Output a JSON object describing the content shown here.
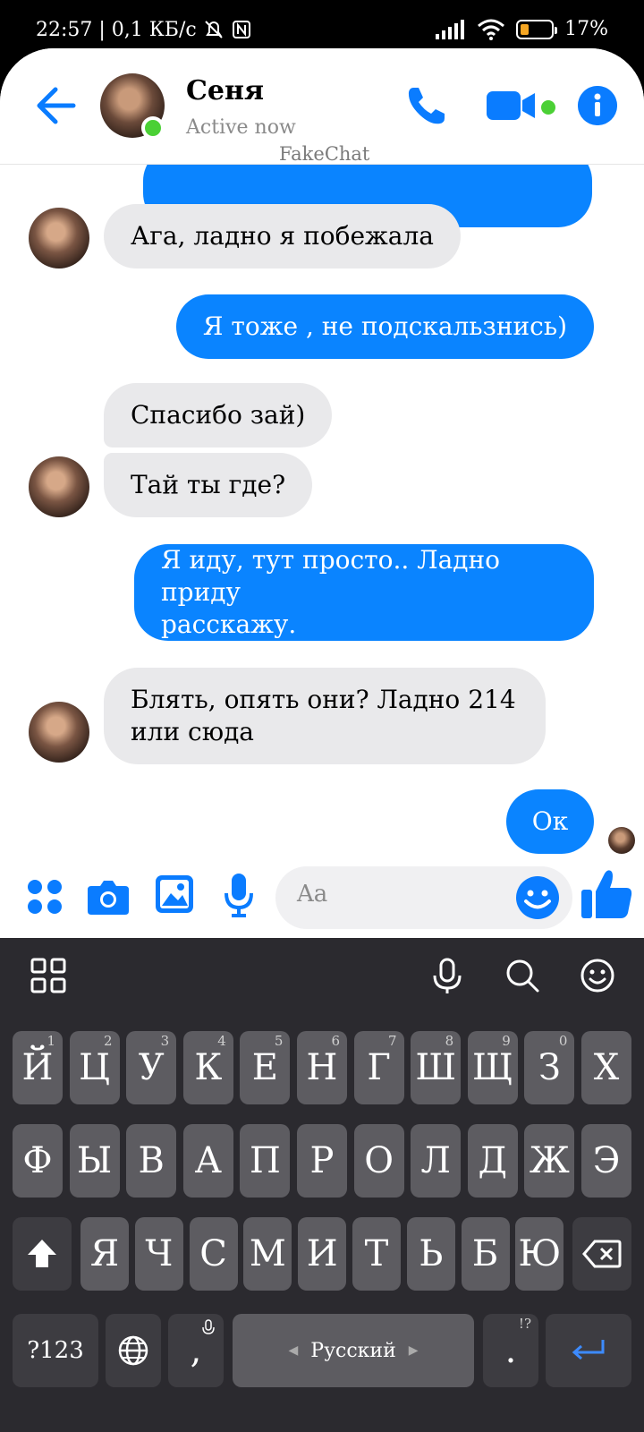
{
  "status_bar": {
    "time_and_speed": "22:57 | 0,1 КБ/с",
    "battery_percent": "17%",
    "battery_level": 0.17
  },
  "header": {
    "contact_name": "Сеня",
    "contact_status": "Active now",
    "watermark": "FakeChat"
  },
  "messages": [
    {
      "text": "Ага, ладно я побежала"
    },
    {
      "text": "Я тоже , не подскальзнись)"
    },
    {
      "text": "Спасибо зай)"
    },
    {
      "text": "Тай ты где?"
    },
    {
      "line1": "Я иду, тут просто.. Ладно приду",
      "line2": "расскажу."
    },
    {
      "line1": "Блять, опять они? Ладно 214",
      "line2": "или сюда"
    },
    {
      "text": "Ок"
    }
  ],
  "composer": {
    "placeholder": "Aa"
  },
  "keyboard": {
    "row1": [
      "Й",
      "Ц",
      "У",
      "К",
      "Е",
      "Н",
      "Г",
      "Ш",
      "Щ",
      "З",
      "Х"
    ],
    "row1_nums": [
      "1",
      "2",
      "3",
      "4",
      "5",
      "6",
      "7",
      "8",
      "9",
      "0"
    ],
    "row2": [
      "Ф",
      "Ы",
      "В",
      "А",
      "П",
      "Р",
      "О",
      "Л",
      "Д",
      "Ж",
      "Э"
    ],
    "row3": [
      "Я",
      "Ч",
      "С",
      "М",
      "И",
      "Т",
      "Ь",
      "Б",
      "Ю"
    ],
    "symbols_key": "?123",
    "comma_key": ",",
    "period_key": ".",
    "period_hint": "!?",
    "space_label": "Русский"
  },
  "colors": {
    "accent": "#0a84ff",
    "incoming_bubble": "#e9e9eb",
    "online": "#4bd035",
    "keyboard_bg": "#2b2a2f"
  }
}
